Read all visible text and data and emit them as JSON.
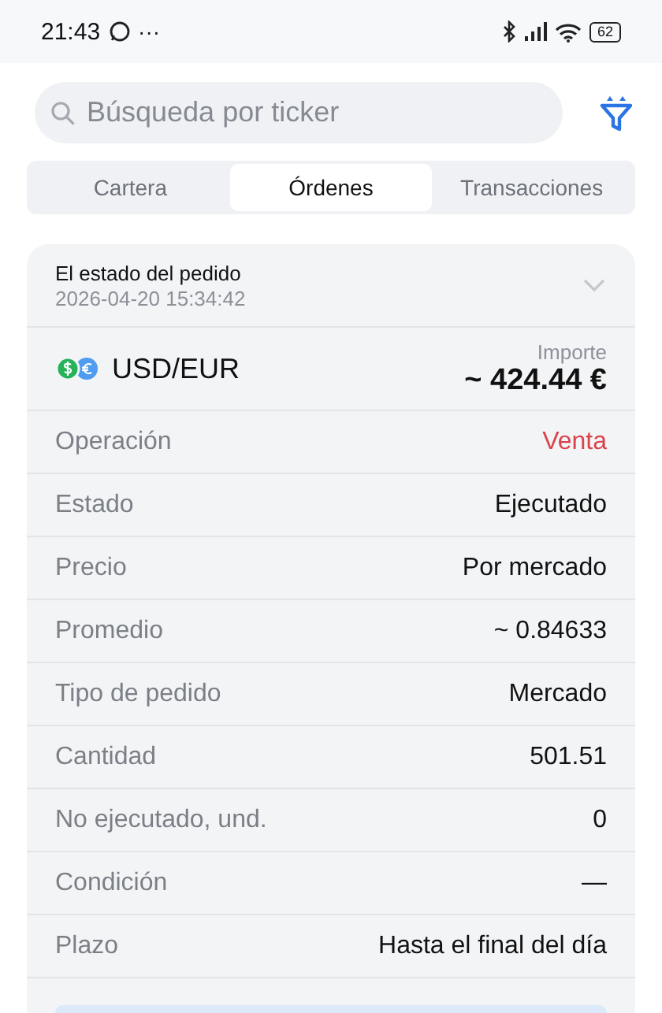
{
  "status_bar": {
    "time": "21:43",
    "more": "···",
    "battery": "62"
  },
  "search": {
    "placeholder": "Búsqueda por ticker"
  },
  "tabs": [
    {
      "label": "Cartera",
      "selected": false
    },
    {
      "label": "Órdenes",
      "selected": true
    },
    {
      "label": "Transacciones",
      "selected": false
    }
  ],
  "order": {
    "title": "El estado del pedido",
    "timestamp": "2026-04-20 15:34:42",
    "expanded": false,
    "pair": "USD/EUR",
    "amount_label": "Importe",
    "amount": "~ 424.44 €",
    "rows": [
      {
        "label": "Operación",
        "value": "Venta",
        "kind": "sell"
      },
      {
        "label": "Estado",
        "value": "Ejecutado",
        "kind": "plain"
      },
      {
        "label": "Precio",
        "value": "Por mercado",
        "kind": "plain"
      },
      {
        "label": "Promedio",
        "value": "~ 0.84633",
        "kind": "plain"
      },
      {
        "label": "Tipo de pedido",
        "value": "Mercado",
        "kind": "plain"
      },
      {
        "label": "Cantidad",
        "value": "501.51",
        "kind": "plain"
      },
      {
        "label": "No ejecutado, und.",
        "value": "0",
        "kind": "plain"
      },
      {
        "label": "Condición",
        "value": "—",
        "kind": "plain"
      },
      {
        "label": "Plazo",
        "value": "Hasta el final del día",
        "kind": "plain"
      }
    ]
  }
}
